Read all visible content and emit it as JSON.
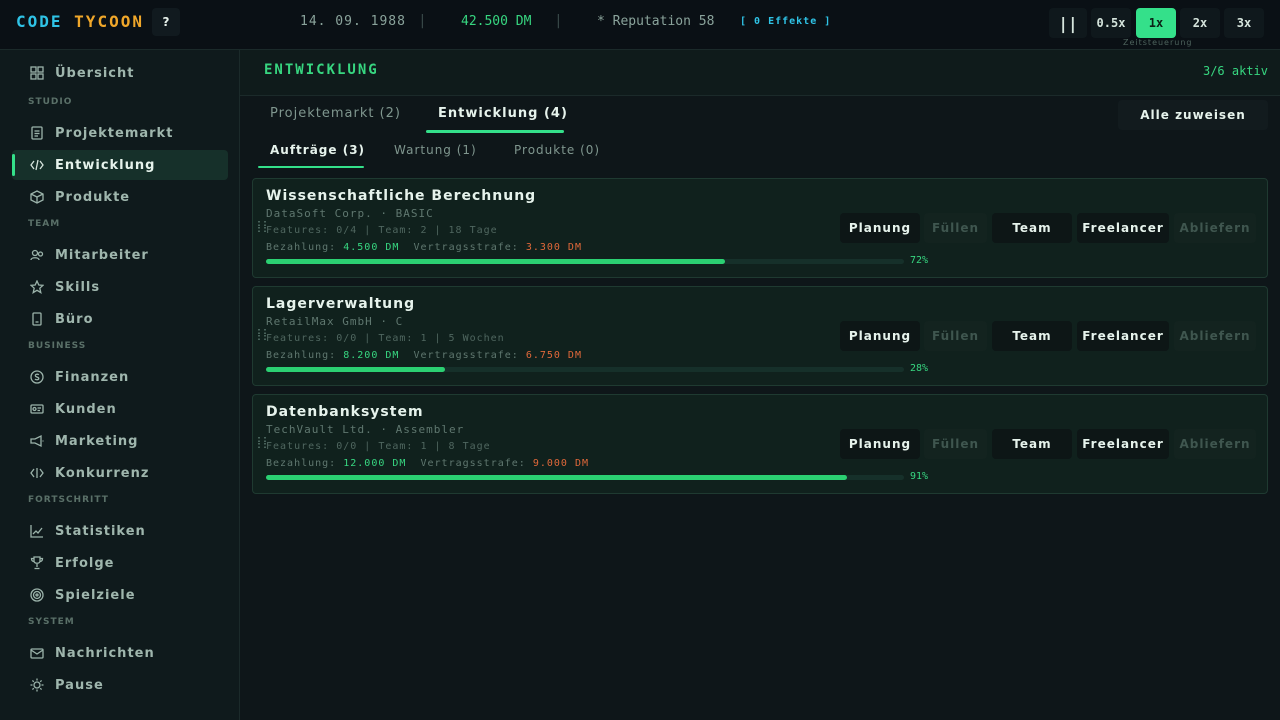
{
  "header": {
    "logo_code": "CODE",
    "logo_tycoon": "TYCOON",
    "help_label": "?",
    "date": "14. 09. 1988",
    "separator": "|",
    "money": "42.500 DM",
    "reputation": "* Reputation 58",
    "effects": "[ 0 Effekte ]",
    "pause_label": "||",
    "speeds": [
      "0.5x",
      "1x",
      "2x",
      "3x"
    ],
    "active_speed": "1x",
    "speed_caption": "Zeitsteuerung"
  },
  "sidebar": {
    "overview": "Übersicht",
    "sections": [
      {
        "title": "STUDIO",
        "items": [
          "Projektemarkt",
          "Entwicklung",
          "Produkte"
        ]
      },
      {
        "title": "TEAM",
        "items": [
          "Mitarbeiter",
          "Skills",
          "Büro"
        ]
      },
      {
        "title": "BUSINESS",
        "items": [
          "Finanzen",
          "Kunden",
          "Marketing",
          "Konkurrenz"
        ]
      },
      {
        "title": "FORTSCHRITT",
        "items": [
          "Statistiken",
          "Erfolge",
          "Spielziele"
        ]
      },
      {
        "title": "SYSTEM",
        "items": [
          "Nachrichten",
          "Pause"
        ]
      }
    ],
    "active_item": "Entwicklung"
  },
  "main": {
    "title": "ENTWICKLUNG",
    "active_count": "3/6 aktiv",
    "tabs": [
      "Projektemarkt (2)",
      "Entwicklung (4)"
    ],
    "active_tab": "Entwicklung (4)",
    "assign_all": "Alle zuweisen",
    "subtabs": [
      "Aufträge (3)",
      "Wartung (1)",
      "Produkte (0)"
    ],
    "active_subtab": "Aufträge (3)",
    "pay_label": "Bezahlung:",
    "penalty_label": "Vertragsstrafe:",
    "buttons": {
      "plan": "Planung",
      "fill": "Füllen",
      "team": "Team",
      "freelancer": "Freelancer",
      "deliver": "Abliefern"
    },
    "projects": [
      {
        "title": "Wissenschaftliche Berechnung",
        "client": "DataSoft Corp. · BASIC",
        "meta": "Features: 0/4  |  Team: 2  |  18 Tage",
        "pay": "4.500 DM",
        "penalty": "3.300 DM",
        "progress": 72,
        "progress_label": "72%"
      },
      {
        "title": "Lagerverwaltung",
        "client": "RetailMax GmbH · C",
        "meta": "Features: 0/0  |  Team: 1  |  5 Wochen",
        "pay": "8.200 DM",
        "penalty": "6.750 DM",
        "progress": 28,
        "progress_label": "28%"
      },
      {
        "title": "Datenbanksystem",
        "client": "TechVault Ltd. · Assembler",
        "meta": "Features: 0/0  |  Team: 1  |  8 Tage",
        "pay": "12.000 DM",
        "penalty": "9.000 DM",
        "progress": 91,
        "progress_label": "91%"
      }
    ]
  }
}
